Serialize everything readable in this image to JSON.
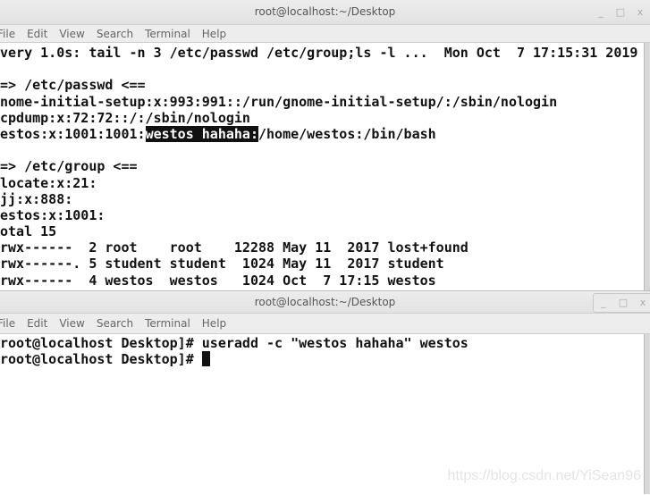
{
  "top_window": {
    "title": "root@localhost:~/Desktop",
    "menu": [
      "File",
      "Edit",
      "View",
      "Search",
      "Terminal",
      "Help"
    ],
    "lines": [
      "very 1.0s: tail -n 3 /etc/passwd /etc/group;ls -l ...  Mon Oct  7 17:15:31 2019",
      "",
      "=> /etc/passwd <==",
      "nome-initial-setup:x:993:991::/run/gnome-initial-setup/:/sbin/nologin",
      "cpdump:x:72:72::/:/sbin/nologin",
      "",
      "",
      "=> /etc/group <==",
      "locate:x:21:",
      "jj:x:888:",
      "estos:x:1001:",
      "otal 15",
      "rwx------  2 root    root    12288 May 11  2017 lost+found",
      "rwx------. 5 student student  1024 May 11  2017 student",
      "rwx------  4 westos  westos   1024 Oct  7 17:15 westos"
    ],
    "highlight_line": {
      "before": "estos:x:1001:1001:",
      "selected": "westos hahaha:",
      "after": "/home/westos:/bin/bash"
    }
  },
  "bottom_window": {
    "title": "root@localhost:~/Desktop",
    "menu": [
      "File",
      "Edit",
      "View",
      "Search",
      "Terminal",
      "Help"
    ],
    "lines": [
      "root@localhost Desktop]# useradd -c \"westos hahaha\" westos"
    ],
    "prompt": "root@localhost Desktop]# "
  },
  "controls": {
    "minimize": "_",
    "maximize": "□",
    "close": "x"
  },
  "watermark": "https://blog.csdn.net/YiSean96"
}
